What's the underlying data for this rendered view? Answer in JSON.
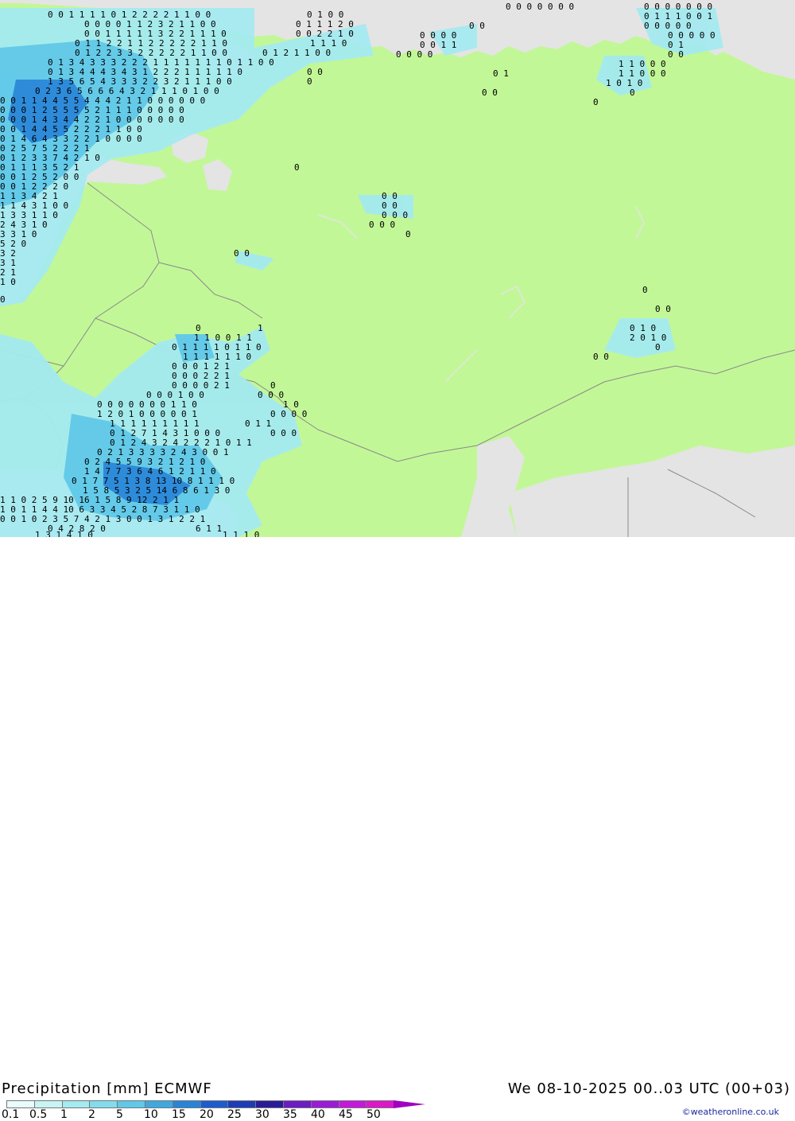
{
  "footer": {
    "title": "Precipitation [mm] ECMWF",
    "run": "We 08-10-2025 00..03 UTC (00+03)",
    "credit": "©weatheronline.co.uk"
  },
  "legend": {
    "labels": [
      "0.1",
      "0.5",
      "1",
      "2",
      "5",
      "10",
      "15",
      "20",
      "25",
      "30",
      "35",
      "40",
      "45",
      "50"
    ],
    "colors": [
      "#e8fcfc",
      "#c8f4f4",
      "#a4eaf0",
      "#82dcec",
      "#60c8e8",
      "#40a8e0",
      "#2884d8",
      "#1c5cd0",
      "#1c3cb8",
      "#2a1c98",
      "#6c1cc4",
      "#9a1cd8",
      "#c418dc",
      "#dc18c8"
    ]
  },
  "colors": {
    "land": "#c2f797",
    "sea_and_outside": "#e4e4e4",
    "precip_light": "#a4eaf0",
    "precip_mid": "#60c8e8",
    "precip_heavy": "#2884d8",
    "border": "#8a8a8a"
  },
  "map": {
    "value_rows": [
      {
        "id": "nw-r1",
        "text": "0 0 1 1 1 1 0 1 2 2 2 2 1 1 0  0",
        "extra": "0 1 0 0"
      },
      {
        "id": "nw-r2",
        "text": "0 0 0 0 1 1 2 3 2 1 1 0  0",
        "extra": "0 1 1 1 2 0"
      },
      {
        "id": "nw-r3",
        "text": "0 0 1 1 1 1 1 3 2 2 1 1 1 0",
        "extra": "0 0 2 2 1 0"
      },
      {
        "id": "nw-r4",
        "text": "0 1 1 2 2 1 1 2 2 2 2 2 1 1 0",
        "extra": "1 1 1 0"
      },
      {
        "id": "nw-r5",
        "text": "0 1 2 2 3 3 2 2 2 2 2 1 1 0 0",
        "extra": "0 1 2 1 1 0 0"
      },
      {
        "id": "nw-r6",
        "text": "0 1 3 4 3 3 3 2 2 2 1 1 1 1 1 1 1 0 1 1 0 0"
      },
      {
        "id": "nw-r7",
        "text": "0 1 3 4 4 4 3 4 3 1 2 2 2 1 1 1 1 1 0",
        "extra": "0 0"
      },
      {
        "id": "nw-r8",
        "text": "1 3 5 6 5 4 3 3 3 2 2 3 2 1 1 1 0 0",
        "extra": "0"
      },
      {
        "id": "nw-r9",
        "text": "0 2 3 6 5 6 6 6 4 3 2 1 1 1 0 1 0 0"
      },
      {
        "id": "nw-r10",
        "text": "0 0 1 1 4 4 5 5 4 4 4 2 1 1 0 0 0 0 0 0"
      },
      {
        "id": "nw-r11",
        "text": "0 0 0 1 2 5 5 5 5 2 1 1 1 0 0 0  0 0"
      },
      {
        "id": "nw-r12",
        "text": "0 0 0 1 4 3 4 4 2 2 1 0 0 0 0 0 0 0"
      },
      {
        "id": "nw-r13",
        "text": "0 0 1 4 4 5 5 2 2 2 1 1 0 0"
      },
      {
        "id": "nw-r14",
        "text": "0 1 4 6 4 3 3 2 2 1 0 0 0 0"
      },
      {
        "id": "nw-r15",
        "text": "0 2 5 7 5 2 2 2 1"
      },
      {
        "id": "nw-r16",
        "text": "0 1 2 3 3 7 4 2 1 0"
      },
      {
        "id": "nw-r17",
        "text": "0 1 1 1 3 5 2 1"
      },
      {
        "id": "nw-r18",
        "text": "0 0 1 2 5 2 0 0"
      },
      {
        "id": "nw-r19",
        "text": "0 0 1 2 2 2 0"
      },
      {
        "id": "nw-r20",
        "text": "1 1 3 4 2 1"
      },
      {
        "id": "nw-r21",
        "text": "1 1 4 3 1 0 0"
      },
      {
        "id": "nw-r22",
        "text": "1 3 3 1 1 0"
      },
      {
        "id": "nw-r23",
        "text": "2 4 3 1 0"
      },
      {
        "id": "nw-r24",
        "text": "3 3 1 0"
      },
      {
        "id": "nw-r25",
        "text": "5 2 0"
      },
      {
        "id": "nw-r26",
        "text": "3 2"
      },
      {
        "id": "nw-r27",
        "text": "3 1"
      },
      {
        "id": "nw-r28",
        "text": "2 1"
      },
      {
        "id": "nw-r29",
        "text": "1 0"
      },
      {
        "id": "nw-r30",
        "text": "0"
      },
      {
        "id": "sw-r1",
        "text": "0",
        "extra": "1"
      },
      {
        "id": "sw-r2",
        "text": "1 1 0  0 1 1"
      },
      {
        "id": "sw-r3",
        "text": "0 1 1 1 1 0 1 1 0"
      },
      {
        "id": "sw-r4",
        "text": "1 1 1 1 1 1 0"
      },
      {
        "id": "sw-r5",
        "text": "0 0 0 1 2 1"
      },
      {
        "id": "sw-r6",
        "text": "0 0 0 2 2 1"
      },
      {
        "id": "sw-r7",
        "text": "0 0 0 0 2 1",
        "extra": "0"
      },
      {
        "id": "sw-r8",
        "text": "0 0  0 1 0 0",
        "extra": "0 0 0"
      },
      {
        "id": "sw-r9",
        "text": "0 0 0 0 0 0 0 1 1 0",
        "extra": "1 0"
      },
      {
        "id": "sw-r10",
        "text": "1 2 0 1 0 0 0 0 0 1",
        "extra": "0 0  0 0"
      },
      {
        "id": "sw-r11",
        "text": "1 1 1 1 1 1 1 1 1",
        "extra": "0 1 1"
      },
      {
        "id": "sw-r12",
        "text": "0 1 2 7 1 4 3 1 0 0 0",
        "extra": "0 0 0"
      },
      {
        "id": "sw-r13",
        "text": "0 1 2 4 3 2 4 2 2 2 1 0 1 1"
      },
      {
        "id": "sw-r14",
        "text": "0 2 1 3 3 3 3 2 4 3 0 0 1"
      },
      {
        "id": "sw-r15",
        "text": "0 2 4 5 5 9 3 2 1 2 1 0"
      },
      {
        "id": "sw-r16",
        "text": "1 4 7 7 3 6 4 6 1 2 1 1 0"
      },
      {
        "id": "sw-r17",
        "text": "0 1 7 7 5 1 3 8 13 10 8 1 1 1 0"
      },
      {
        "id": "sw-r18",
        "text": "1 5 8 5 3 2 5 14 6 8 6 1 3 0"
      },
      {
        "id": "sw-r19",
        "text": "1 1  0 2 5 9 10 16 1 5 8 9 12 2 1 1"
      },
      {
        "id": "sw-r20",
        "text": "1 0 1  1 4 4 10 6 3 3 4 5 2 8 7 3 1 1 0"
      },
      {
        "id": "sw-r21",
        "text": "0 0 1 0 2 3 5 7 4 2 1 3 0 0 1 3 1 2 2 1"
      },
      {
        "id": "sw-r22",
        "text": "0 4 2 8 2 0",
        "extra": "6 1 1"
      },
      {
        "id": "sw-r23",
        "text": "1 3 1 4 1 0",
        "extra": "1 1 1 0"
      },
      {
        "id": "ne-r1",
        "text": "0 0 0 0 0  0 0",
        "extra": "0 0 0 0 0 0 0"
      },
      {
        "id": "ne-r2",
        "text": "0 1 1 1 0 0 1"
      },
      {
        "id": "ne-r3",
        "text": "0 0 0 0 0",
        "extra": "0  0"
      },
      {
        "id": "ne-r4",
        "text": "0 0  0 0",
        "extra": "0 0   0  0 0"
      },
      {
        "id": "ne-r5",
        "text": "0 0 1 1",
        "extra": "0 1"
      },
      {
        "id": "ne-r6",
        "text": "0 0 0 0",
        "extra": "0   0"
      },
      {
        "id": "ne-r7",
        "text": "1 1  0 0 0"
      },
      {
        "id": "ne-r8",
        "text": "1 1   0 0 0",
        "extra": "0 1"
      },
      {
        "id": "ne-r9",
        "text": "1 0 1  0"
      },
      {
        "id": "ne-r10",
        "text": "0  0",
        "extra": "0"
      },
      {
        "id": "ne-r11",
        "text": "0"
      },
      {
        "id": "c-r1",
        "text": "0 0"
      },
      {
        "id": "c-r2",
        "text": "0 0"
      },
      {
        "id": "c-r3",
        "text": "0 0 0"
      },
      {
        "id": "c-r4",
        "text": "0  0 0"
      },
      {
        "id": "c-r5",
        "text": "0"
      },
      {
        "id": "c-r6",
        "text": "0   0"
      },
      {
        "id": "c-r7",
        "text": "0"
      },
      {
        "id": "e-r1",
        "text": "0"
      },
      {
        "id": "e-r2",
        "text": "0 0"
      },
      {
        "id": "e-r3",
        "text": "0 1 0"
      },
      {
        "id": "e-r4",
        "text": "2 0 1 0"
      },
      {
        "id": "e-r5",
        "text": "0"
      },
      {
        "id": "e-r6",
        "text": "0   0"
      }
    ]
  }
}
